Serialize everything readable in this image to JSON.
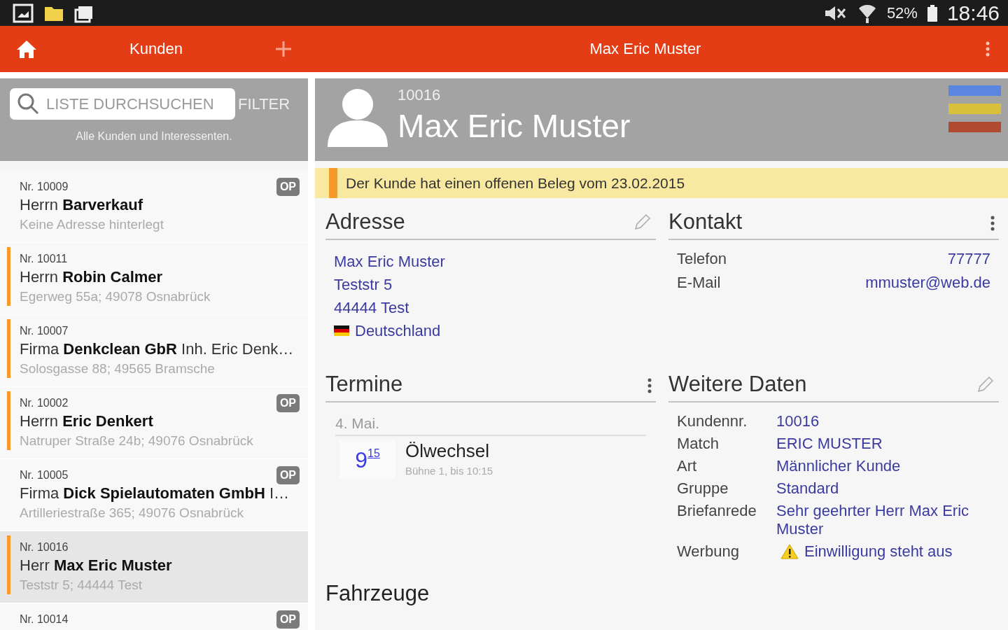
{
  "status_bar": {
    "battery": "52%",
    "time": "18:46"
  },
  "app_bar": {
    "list_title": "Kunden",
    "detail_title": "Max Eric Muster"
  },
  "search": {
    "placeholder": "LISTE DURCHSUCHEN",
    "filter": "FILTER",
    "hint": "Alle Kunden und Interessenten."
  },
  "customers": [
    {
      "nr": "Nr. 10009",
      "name": "Herrn **Barverkauf**",
      "address": "Keine Adresse hinterlegt",
      "op": "OP",
      "marked": false,
      "selected": false
    },
    {
      "nr": "Nr. 10011",
      "name": "Herrn **Robin Calmer**",
      "address": "Egerweg 55a; 49078 Osnabrück",
      "marked": true,
      "selected": false
    },
    {
      "nr": "Nr. 10007",
      "name": "Firma **Denkclean GbR** Inh. Eric Denk…",
      "address": "Solosgasse 88; 49565 Bramsche",
      "marked": true,
      "selected": false
    },
    {
      "nr": "Nr. 10002",
      "name": "Herrn **Eric Denkert**",
      "address": "Natruper Straße 24b; 49076 Osnabrück",
      "op": "OP",
      "marked": true,
      "selected": false
    },
    {
      "nr": "Nr. 10005",
      "name": "Firma **Dick Spielautomaten GmbH** I…",
      "address": "Artilleriestraße 365; 49076 Osnabrück",
      "op": "OP",
      "marked": false,
      "selected": false
    },
    {
      "nr": "Nr. 10016",
      "name": "Herr **Max Eric Muster**",
      "address": "Teststr 5; 44444 Test",
      "marked": true,
      "selected": true
    },
    {
      "nr": "Nr. 10014",
      "op": "OP",
      "marked": false,
      "selected": false
    }
  ],
  "detail": {
    "number": "10016",
    "name": "Max Eric Muster",
    "tags": [
      {
        "color": "#5b86e0"
      },
      {
        "color": "#d8c03a"
      },
      {
        "color": "#b04a30"
      }
    ],
    "notice": "Der Kunde hat einen offenen Beleg vom 23.02.2015",
    "address": {
      "title": "Adresse",
      "lines": [
        {
          "text": "Max Eric Muster"
        },
        {
          "text": "Teststr 5"
        },
        {
          "text": "44444 Test"
        },
        {
          "text": "Deutschland",
          "kind": "country"
        }
      ]
    },
    "contact": {
      "title": "Kontakt",
      "rows": [
        {
          "label": "Telefon",
          "value": "77777"
        },
        {
          "label": "E-Mail",
          "value": "mmuster@web.de"
        }
      ]
    },
    "appointments": {
      "title": "Termine",
      "date": "4. Mai.",
      "items": [
        {
          "hour": "9",
          "minute": "15",
          "title": "Ölwechsel",
          "details": "Bühne 1, bis 10:15"
        }
      ]
    },
    "more": {
      "title": "Weitere Daten",
      "rows": [
        {
          "label": "Kundennr.",
          "value": "10016"
        },
        {
          "label": "Match",
          "value": "ERIC MUSTER"
        },
        {
          "label": "Art",
          "value": "Männlicher Kunde"
        },
        {
          "label": "Gruppe",
          "value": "Standard"
        },
        {
          "label": "Briefanrede",
          "value": "Sehr geehrter Herr Max Eric Muster"
        },
        {
          "label": "Werbung",
          "value": "Einwilligung steht aus",
          "kind": "warning"
        }
      ]
    },
    "vehicles": {
      "title": "Fahrzeuge"
    }
  }
}
